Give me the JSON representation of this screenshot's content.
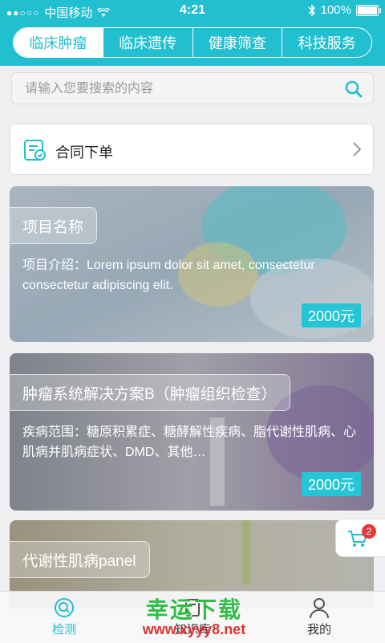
{
  "status": {
    "carrier": "中国移动",
    "time": "4:21",
    "battery": "100%",
    "signal_dots": "●●○○○"
  },
  "tabs": [
    {
      "label": "临床肿瘤",
      "active": true
    },
    {
      "label": "临床遗传",
      "active": false
    },
    {
      "label": "健康筛查",
      "active": false
    },
    {
      "label": "科技服务",
      "active": false
    }
  ],
  "search": {
    "placeholder": "请输入您要搜索的内容",
    "value": ""
  },
  "contract": {
    "label": "合同下单"
  },
  "cards": [
    {
      "title": "项目名称",
      "desc": "项目介绍：Lorem ipsum dolor sit amet, consectetur consectetur adipiscing elit.",
      "price": "2000元"
    },
    {
      "title": "肿瘤系统解决方案B（肿瘤组织检查）",
      "desc": "疾病范围：糖原积累症、糖酵解性疾病、脂代谢性肌病、心肌病并肌病症状、DMD、其他…",
      "price": "2000元"
    },
    {
      "title": "代谢性肌病panel",
      "desc": "",
      "price": ""
    }
  ],
  "cart": {
    "badge": "2"
  },
  "nav": [
    {
      "label": "检测",
      "icon": "detect-icon",
      "active": true
    },
    {
      "label": "知识库",
      "icon": "knowledge-icon",
      "active": false
    },
    {
      "label": "我的",
      "icon": "user-icon",
      "active": false
    }
  ],
  "watermark": {
    "text": "幸运下载",
    "url": "www.xyyy8.net"
  },
  "colors": {
    "accent": "#21bfd0",
    "price": "#25c5d7",
    "badge": "#e23b3b"
  }
}
